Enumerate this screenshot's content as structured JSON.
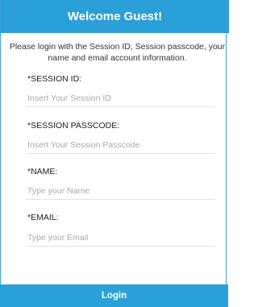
{
  "header": {
    "title": "Welcome Guest!"
  },
  "intro": {
    "text": "Please login with the Session ID, Session passcode, your name and email account information."
  },
  "fields": {
    "session_id": {
      "label": "*SESSION ID:",
      "placeholder": "Insert Your Session ID",
      "value": ""
    },
    "session_passcode": {
      "label": "*SESSION PASSCODE:",
      "placeholder": "Insert Your Session Passcode",
      "value": ""
    },
    "name": {
      "label": "*NAME:",
      "placeholder": "Type your Name",
      "value": ""
    },
    "email": {
      "label": "*EMAIL:",
      "placeholder": "Type your Email",
      "value": ""
    }
  },
  "login_button": {
    "label": "Login"
  },
  "colors": {
    "accent": "#2b9fd8",
    "border": "#3ca3de",
    "placeholder": "#a8a8a8"
  }
}
